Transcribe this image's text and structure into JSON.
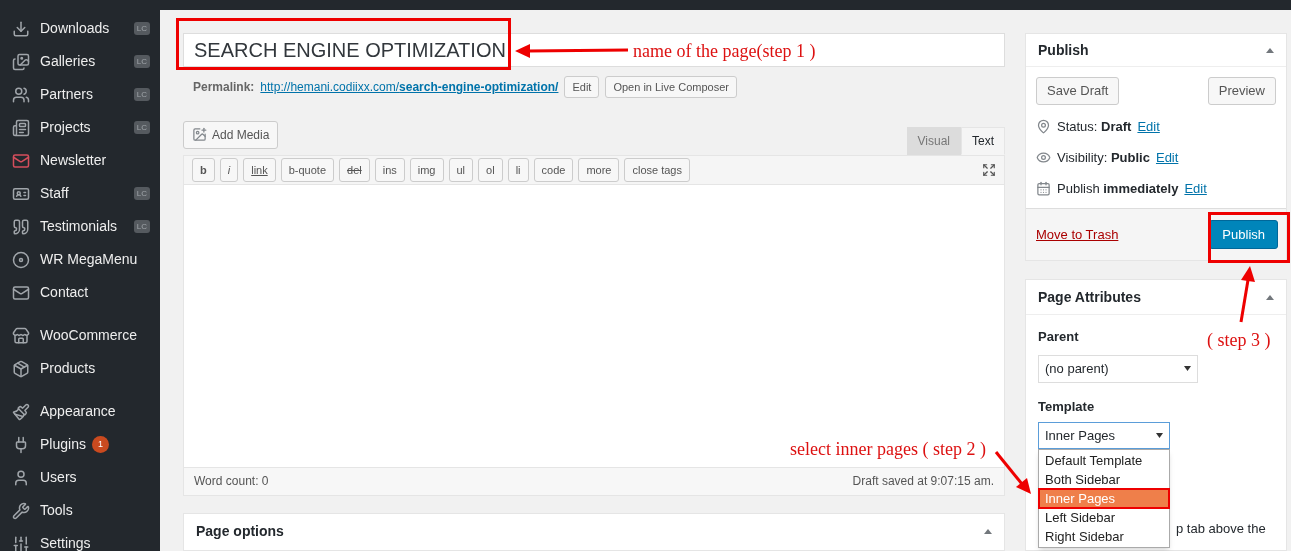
{
  "sidebar": {
    "groups": [
      {
        "items": [
          {
            "label": "Downloads",
            "badge": "LC"
          },
          {
            "label": "Galleries",
            "badge": "LC"
          },
          {
            "label": "Partners",
            "badge": "LC"
          },
          {
            "label": "Projects",
            "badge": "LC"
          },
          {
            "label": "Newsletter"
          },
          {
            "label": "Staff",
            "badge": "LC"
          },
          {
            "label": "Testimonials",
            "badge": "LC"
          },
          {
            "label": "WR MegaMenu"
          },
          {
            "label": "Contact"
          }
        ]
      },
      {
        "items": [
          {
            "label": "WooCommerce"
          },
          {
            "label": "Products"
          }
        ]
      },
      {
        "items": [
          {
            "label": "Appearance"
          },
          {
            "label": "Plugins",
            "count": "1"
          },
          {
            "label": "Users"
          },
          {
            "label": "Tools"
          },
          {
            "label": "Settings"
          }
        ]
      }
    ]
  },
  "editor": {
    "title": "SEARCH ENGINE OPTIMIZATION",
    "permalink": {
      "label": "Permalink:",
      "base": "http://hemani.codiixx.com/",
      "slug": "search-engine-optimization/",
      "buttons": [
        "Edit",
        "Open in Live Composer"
      ]
    },
    "add_media": "Add Media",
    "tabs": [
      {
        "label": "Visual",
        "selected": false
      },
      {
        "label": "Text",
        "selected": true
      }
    ],
    "toolbar": [
      {
        "label": "b",
        "kind": "bold"
      },
      {
        "label": "i",
        "kind": "italic"
      },
      {
        "label": "link",
        "kind": "underline"
      },
      {
        "label": "b-quote",
        "kind": "plain"
      },
      {
        "label": "del",
        "kind": "strike"
      },
      {
        "label": "ins",
        "kind": "plain"
      },
      {
        "label": "img",
        "kind": "plain"
      },
      {
        "label": "ul",
        "kind": "plain"
      },
      {
        "label": "ol",
        "kind": "plain"
      },
      {
        "label": "li",
        "kind": "plain"
      },
      {
        "label": "code",
        "kind": "plain"
      },
      {
        "label": "more",
        "kind": "plain"
      },
      {
        "label": "close tags",
        "kind": "plain"
      }
    ],
    "word_count": "Word count: 0",
    "draft_saved": "Draft saved at 9:07:15 am."
  },
  "page_options": {
    "title": "Page options"
  },
  "publish": {
    "title": "Publish",
    "save_draft": "Save Draft",
    "preview": "Preview",
    "rows": [
      {
        "text": "Status: **Draft**",
        "link": "Edit"
      },
      {
        "text": "Visibility: **Public**",
        "link": "Edit"
      },
      {
        "text": "Publish **immediately**",
        "link": "Edit"
      }
    ],
    "trash": "Move to Trash",
    "publish_button": "Publish"
  },
  "page_attributes": {
    "title": "Page Attributes",
    "parent_label": "Parent",
    "parent_value": "(no parent)",
    "template_label": "Template",
    "template_value": "Inner Pages",
    "options": [
      {
        "label": "Default Template",
        "selected": false
      },
      {
        "label": "Both Sidebar",
        "selected": false
      },
      {
        "label": "Inner Pages",
        "selected": true
      },
      {
        "label": "Left Sidebar",
        "selected": false
      },
      {
        "label": "Right Sidebar",
        "selected": false
      }
    ],
    "help": "p tab above the"
  },
  "annotations": [
    {
      "text": "name of the page(step 1 )"
    },
    {
      "text": "( step 3 )"
    },
    {
      "text": "select inner pages ( step 2 )"
    }
  ]
}
